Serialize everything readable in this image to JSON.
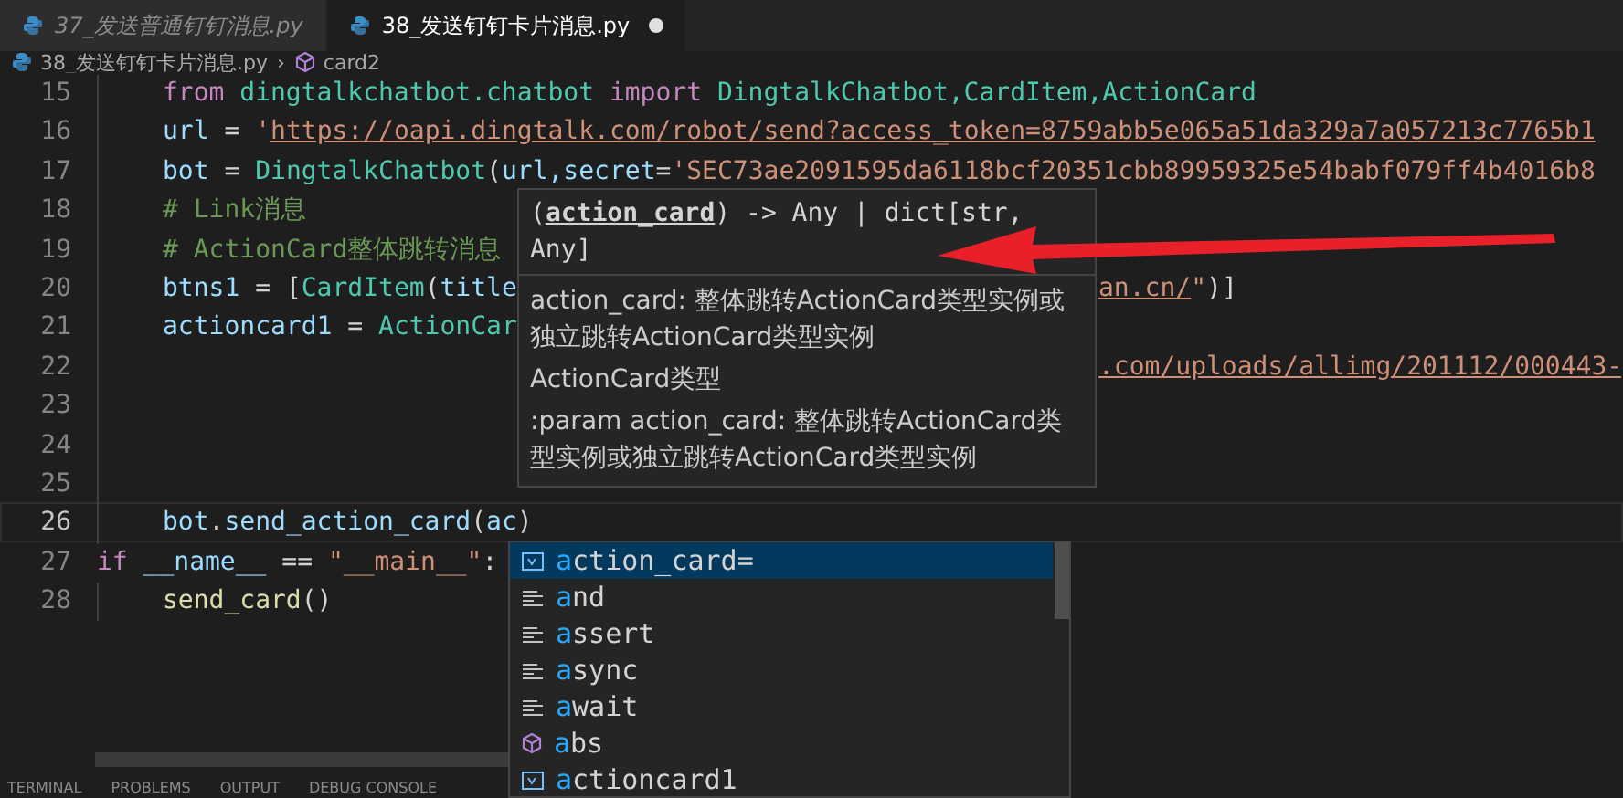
{
  "tabs": [
    {
      "label": "37_发送普通钉钉消息.py",
      "selected": false,
      "modified": false
    },
    {
      "label": "38_发送钉钉卡片消息.py",
      "selected": true,
      "modified": true
    }
  ],
  "breadcrumb": {
    "separator": "›",
    "items": [
      {
        "label": "38_发送钉钉卡片消息.py",
        "kind": "file"
      },
      {
        "label": "card2",
        "kind": "symbol"
      }
    ]
  },
  "editor": {
    "lines": [
      {
        "number": "15",
        "current": false,
        "indented": true,
        "tokens": [
          {
            "kind": "keyword",
            "text": "from"
          },
          {
            "kind": "class",
            "text": " dingtalkchatbot.chatbot "
          },
          {
            "kind": "keyword",
            "text": "import"
          },
          {
            "kind": "class",
            "text": " DingtalkChatbot,CardItem,ActionCard"
          }
        ]
      },
      {
        "number": "16",
        "current": false,
        "indented": true,
        "tokens": [
          {
            "kind": "variable",
            "text": "url"
          },
          {
            "kind": "plain",
            "text": " = "
          },
          {
            "kind": "string",
            "text": "'"
          },
          {
            "kind": "link",
            "text": "https://oapi.dingtalk.com/robot/send?access_token=8759abb5e065a51da329a7a057213c7765b1"
          }
        ]
      },
      {
        "number": "17",
        "current": false,
        "indented": true,
        "tokens": [
          {
            "kind": "variable",
            "text": "bot"
          },
          {
            "kind": "plain",
            "text": " = "
          },
          {
            "kind": "class",
            "text": "DingtalkChatbot"
          },
          {
            "kind": "plain",
            "text": "("
          },
          {
            "kind": "variable",
            "text": "url,secret"
          },
          {
            "kind": "plain",
            "text": "="
          },
          {
            "kind": "string",
            "text": "'SEC73ae2091595da6118bcf20351cbb89959325e54babf079ff4b4016b8"
          }
        ]
      },
      {
        "number": "18",
        "current": false,
        "indented": true,
        "tokens": [
          {
            "kind": "comment",
            "text": "# Link消息"
          }
        ]
      },
      {
        "number": "19",
        "current": false,
        "indented": true,
        "tokens": [
          {
            "kind": "comment",
            "text": "# ActionCard整体跳转消息"
          }
        ]
      },
      {
        "number": "20",
        "current": false,
        "indented": true,
        "tokens": [
          {
            "kind": "variable",
            "text": "btns1"
          },
          {
            "kind": "plain",
            "text": " = ["
          },
          {
            "kind": "class",
            "text": "CardItem"
          },
          {
            "kind": "plain",
            "text": "("
          },
          {
            "kind": "variable",
            "text": "title"
          }
        ],
        "tail": [
          {
            "kind": "link",
            "text": "an.cn/"
          },
          {
            "kind": "string",
            "text": "\""
          },
          {
            "kind": "plain",
            "text": ")]"
          }
        ]
      },
      {
        "number": "21",
        "current": false,
        "indented": true,
        "tokens": [
          {
            "kind": "variable",
            "text": "actioncard1"
          },
          {
            "kind": "plain",
            "text": " = "
          },
          {
            "kind": "class",
            "text": "ActionCar"
          }
        ]
      },
      {
        "number": "22",
        "current": false,
        "indented": true,
        "tail": [
          {
            "kind": "link",
            "text": ".com/uploads/allimg/201112/000443-"
          }
        ]
      },
      {
        "number": "23",
        "current": false,
        "indented": true
      },
      {
        "number": "24",
        "current": false,
        "indented": true
      },
      {
        "number": "25",
        "current": false,
        "indented": true
      },
      {
        "number": "26",
        "current": true,
        "indented": true,
        "tokens": [
          {
            "kind": "variable",
            "text": "bot"
          },
          {
            "kind": "plain",
            "text": "."
          },
          {
            "kind": "variable",
            "text": "send_action_card"
          },
          {
            "kind": "plain",
            "text": "("
          },
          {
            "kind": "variable",
            "text": "ac"
          },
          {
            "kind": "plain",
            "text": ")"
          }
        ]
      },
      {
        "number": "27",
        "current": false,
        "tokens": [
          {
            "kind": "keyword",
            "text": "if"
          },
          {
            "kind": "variable",
            "text": " __name__ "
          },
          {
            "kind": "plain",
            "text": "== "
          },
          {
            "kind": "string",
            "text": "\"__main__\""
          },
          {
            "kind": "plain",
            "text": ":"
          }
        ]
      },
      {
        "number": "28",
        "current": false,
        "indented": true,
        "tokens": [
          {
            "kind": "function",
            "text": "send_card"
          },
          {
            "kind": "plain",
            "text": "()"
          }
        ]
      }
    ]
  },
  "hover": {
    "signature": "(**action_card**) -> Any | dict[str, Any]",
    "docs": [
      "action_card: 整体跳转ActionCard类型实例或独立跳转ActionCard类型实例",
      "ActionCard类型",
      ":param action_card: 整体跳转ActionCard类型实例或独立跳转ActionCard类型实例"
    ]
  },
  "suggestions": [
    {
      "label": "action_card=",
      "kind": "variable",
      "selected": true
    },
    {
      "label": "and",
      "kind": "keyword",
      "selected": false
    },
    {
      "label": "assert",
      "kind": "keyword",
      "selected": false
    },
    {
      "label": "async",
      "kind": "keyword",
      "selected": false
    },
    {
      "label": "await",
      "kind": "keyword",
      "selected": false
    },
    {
      "label": "abs",
      "kind": "function",
      "selected": false
    },
    {
      "label": "actioncard1",
      "kind": "variable",
      "selected": false
    }
  ],
  "panel_tabs": [
    "TERMINAL",
    "PROBLEMS",
    "OUTPUT",
    "DEBUG CONSOLE"
  ]
}
